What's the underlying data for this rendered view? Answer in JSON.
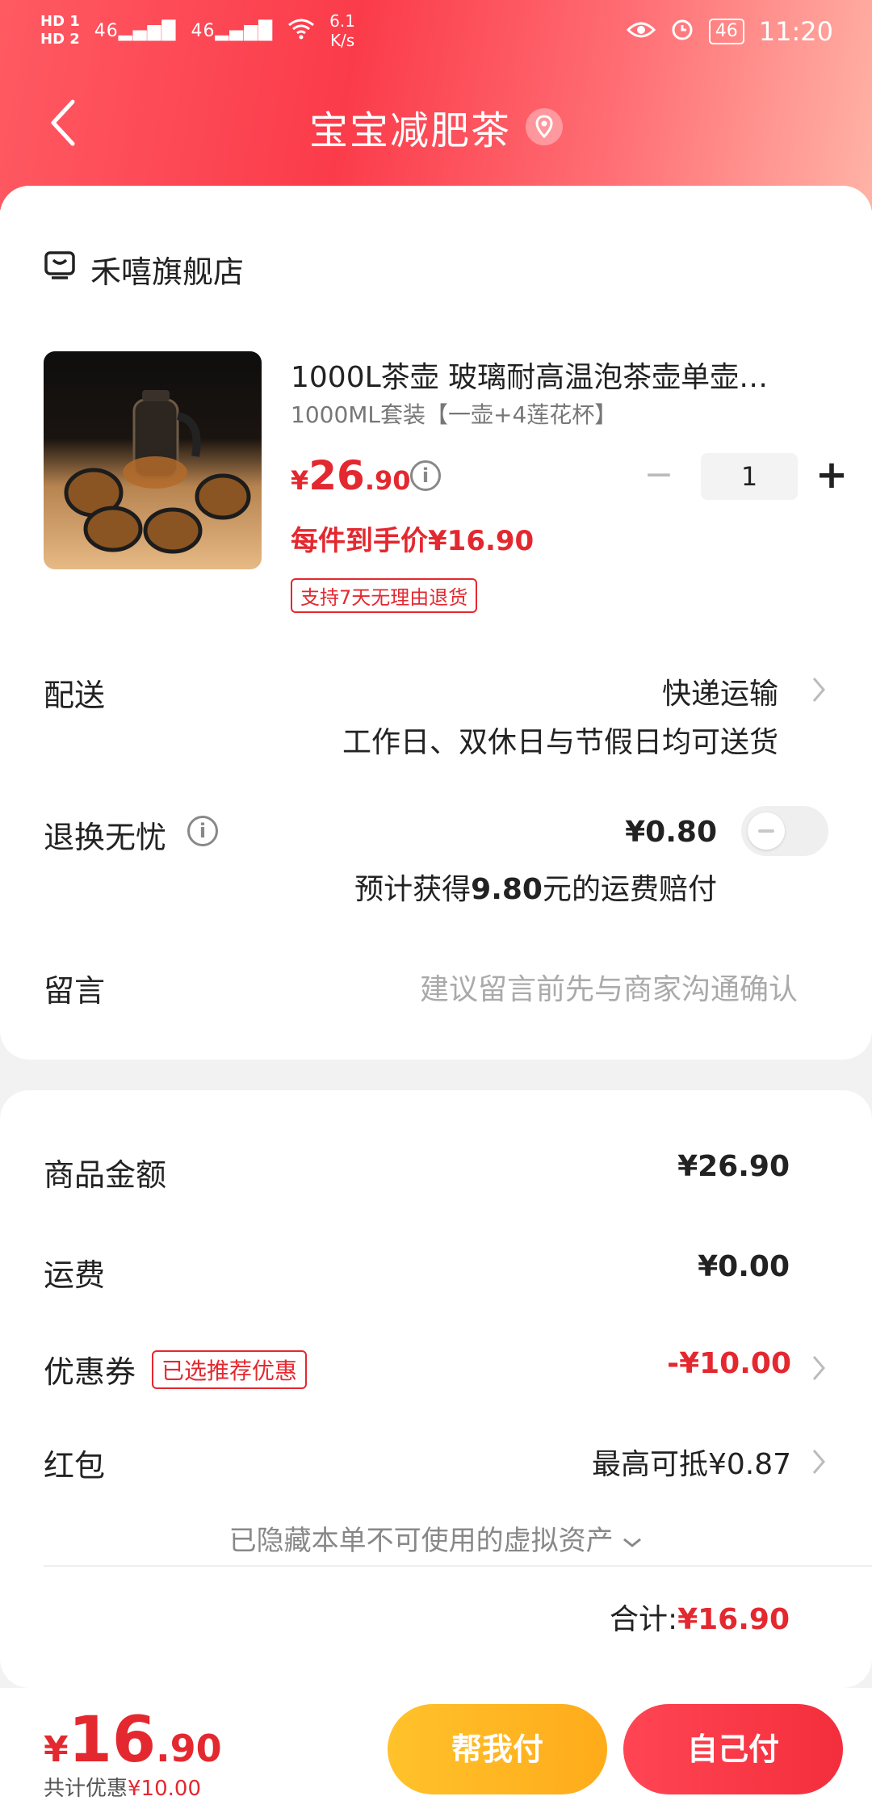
{
  "status_bar": {
    "hd1": "HD 1",
    "hd2": "HD 2",
    "signal1": "46",
    "signal2": "46",
    "speed_value": "6.1",
    "speed_unit": "K/s",
    "battery": "46",
    "time": "11:20"
  },
  "header": {
    "title": "宝宝减肥茶",
    "back_icon": "chevron-left-icon",
    "location_icon": "location-pin-icon"
  },
  "order": {
    "shop_name": "禾嘻旗舰店",
    "product": {
      "title": "1000L茶壶 玻璃耐高温泡茶壶单壶…",
      "spec": "1000ML套装【一壶+4莲花杯】",
      "price_symbol": "¥",
      "price_int": "26",
      "price_dec": ".90",
      "deal_price": "每件到手价¥16.90",
      "return_badge": "支持7天无理由退货",
      "quantity": "1",
      "minus": "−",
      "plus": "+"
    },
    "delivery": {
      "label": "配送",
      "method": "快递运输",
      "note": "工作日、双休日与节假日均可送货"
    },
    "worry_free": {
      "label": "退换无忧",
      "price": "¥0.80",
      "note_prefix": "预计获得",
      "note_value": "9.80",
      "note_suffix": "元的运费赔付"
    },
    "message": {
      "label": "留言",
      "placeholder": "建议留言前先与商家沟通确认"
    }
  },
  "summary": {
    "goods_amount_label": "商品金额",
    "goods_amount": "¥26.90",
    "shipping_label": "运费",
    "shipping": "¥0.00",
    "coupon_label": "优惠券",
    "coupon_badge": "已选推荐优惠",
    "coupon_value": "-¥10.00",
    "red_packet_label": "红包",
    "red_packet_value": "最高可抵¥0.87",
    "hidden_assets": "已隐藏本单不可使用的虚拟资产",
    "total_label": "合计:",
    "total_value": "¥16.90"
  },
  "bottom_bar": {
    "price_symbol": "¥",
    "price_int": "16",
    "price_dec": ".90",
    "saving_label": "共计优惠",
    "saving_value": "¥10.00",
    "help_pay": "帮我付",
    "self_pay": "自己付"
  },
  "colors": {
    "accent": "#e4282f",
    "header_start": "#ff5a63",
    "button_orange": "#ffb320",
    "button_red": "#f42e3c"
  }
}
